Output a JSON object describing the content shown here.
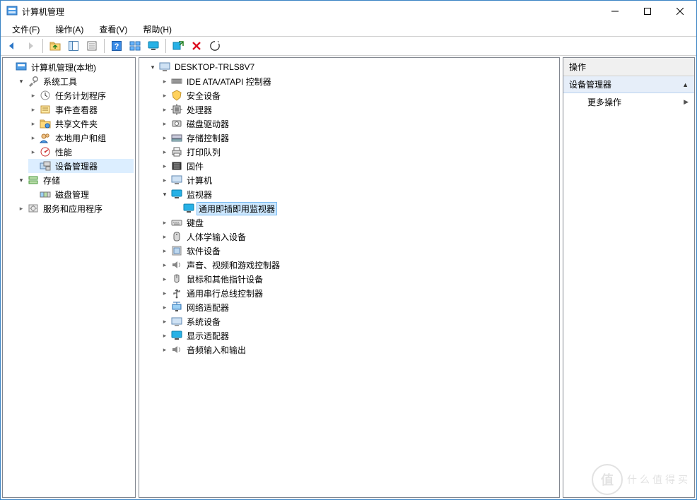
{
  "window": {
    "title": "计算机管理"
  },
  "menu": {
    "file": "文件(F)",
    "action": "操作(A)",
    "view": "查看(V)",
    "help": "帮助(H)"
  },
  "toolbar": {
    "back": "back-icon",
    "forward": "forward-icon",
    "up": "up-icon",
    "show_hide_tree": "show-hide-tree-icon",
    "properties": "properties-icon",
    "help": "help-icon",
    "view_mode": "view-mode-icon",
    "monitor": "monitor-icon",
    "scan": "scan-icon",
    "delete": "delete-icon",
    "refresh": "refresh-icon"
  },
  "left_tree": {
    "root": "计算机管理(本地)",
    "sys_tools": "系统工具",
    "task_scheduler": "任务计划程序",
    "event_viewer": "事件查看器",
    "shared_folders": "共享文件夹",
    "local_users": "本地用户和组",
    "performance": "性能",
    "device_manager": "设备管理器",
    "storage": "存储",
    "disk_mgmt": "磁盘管理",
    "services_apps": "服务和应用程序"
  },
  "center_tree": {
    "root": "DESKTOP-TRLS8V7",
    "ide": "IDE ATA/ATAPI 控制器",
    "security": "安全设备",
    "cpu": "处理器",
    "disk_drives": "磁盘驱动器",
    "storage_ctrl": "存储控制器",
    "print_queue": "打印队列",
    "firmware": "固件",
    "computer": "计算机",
    "monitors": "监视器",
    "pnp_monitor": "通用即插即用监视器",
    "keyboard": "键盘",
    "hid": "人体学输入设备",
    "software_dev": "软件设备",
    "sound": "声音、视频和游戏控制器",
    "mouse": "鼠标和其他指针设备",
    "usb": "通用串行总线控制器",
    "network": "网络适配器",
    "system_dev": "系统设备",
    "display": "显示适配器",
    "audio_io": "音频输入和输出"
  },
  "actions": {
    "header": "操作",
    "section": "设备管理器",
    "more": "更多操作"
  },
  "watermark": {
    "logo": "值",
    "text": "什么值得买"
  }
}
